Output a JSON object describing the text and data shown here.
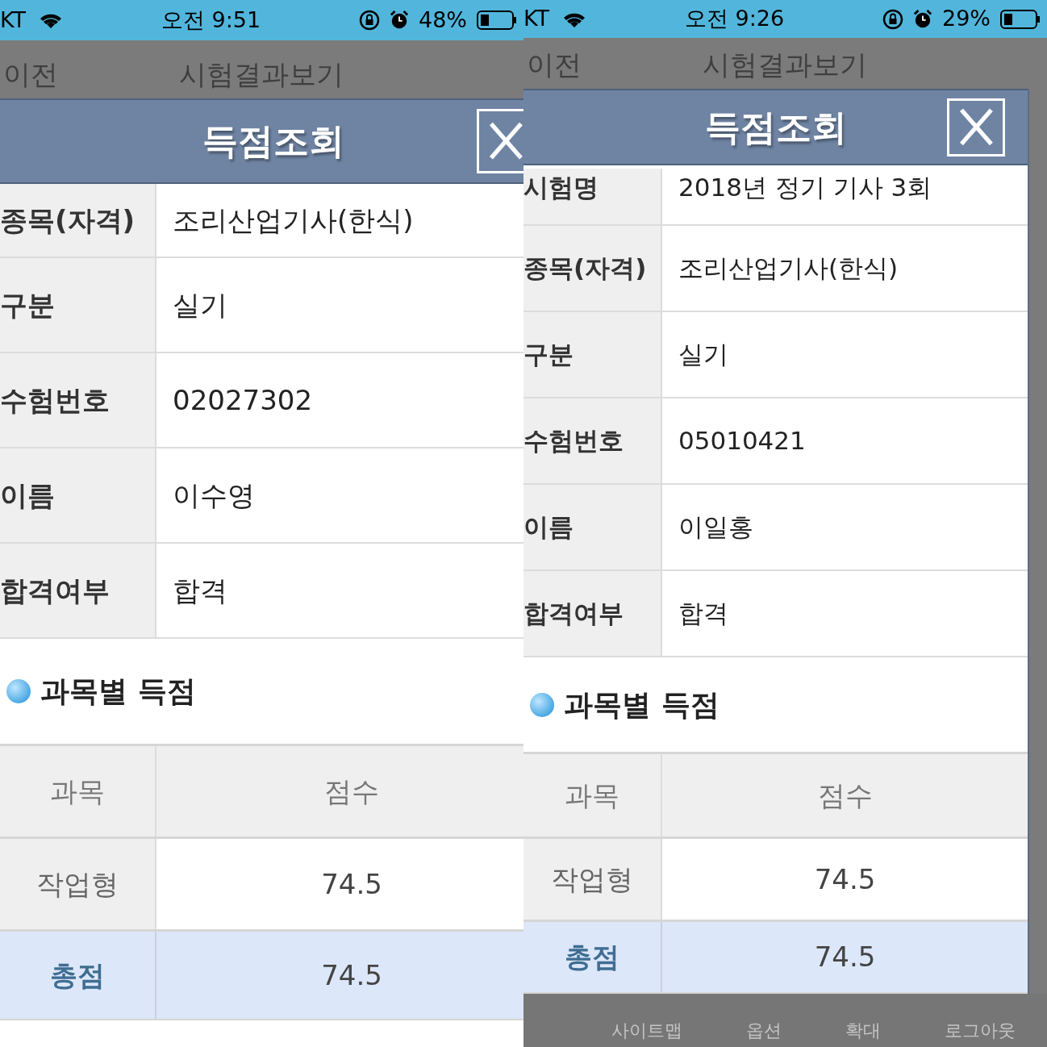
{
  "phones": [
    {
      "status_bar": {
        "carrier": "KT",
        "time": "오전 9:51",
        "battery": "48%"
      },
      "nav": {
        "back": "이전",
        "title": "시험결과보기"
      },
      "dialog": {
        "title": "득점조회",
        "rows": [
          {
            "label": "종목(자격)",
            "value": "조리산업기사(한식)"
          },
          {
            "label": "구분",
            "value": "실기"
          },
          {
            "label": "수험번호",
            "value": "02027302"
          },
          {
            "label": "이름",
            "value": "이수영"
          },
          {
            "label": "합격여부",
            "value": "합격"
          }
        ],
        "section_title": "과목별 득점",
        "columns": [
          "과목",
          "점수"
        ],
        "scores": [
          {
            "subject": "작업형",
            "score": "74.5"
          }
        ],
        "total": {
          "label": "총점",
          "score": "74.5"
        }
      }
    },
    {
      "status_bar": {
        "carrier": "KT",
        "time": "오전 9:26",
        "battery": "29%"
      },
      "nav": {
        "back": "이전",
        "title": "시험결과보기"
      },
      "dialog": {
        "title": "득점조회",
        "rows": [
          {
            "label": "시험명",
            "value": "2018년 정기 기사 3회"
          },
          {
            "label": "종목(자격)",
            "value": "조리산업기사(한식)"
          },
          {
            "label": "구분",
            "value": "실기"
          },
          {
            "label": "수험번호",
            "value": "05010421"
          },
          {
            "label": "이름",
            "value": "이일홍"
          },
          {
            "label": "합격여부",
            "value": "합격"
          }
        ],
        "section_title": "과목별 득점",
        "columns": [
          "과목",
          "점수"
        ],
        "scores": [
          {
            "subject": "작업형",
            "score": "74.5"
          }
        ],
        "total": {
          "label": "총점",
          "score": "74.5"
        }
      },
      "tab_bar": [
        "사이트맵",
        "옵션",
        "확대",
        "로그아웃"
      ]
    }
  ]
}
